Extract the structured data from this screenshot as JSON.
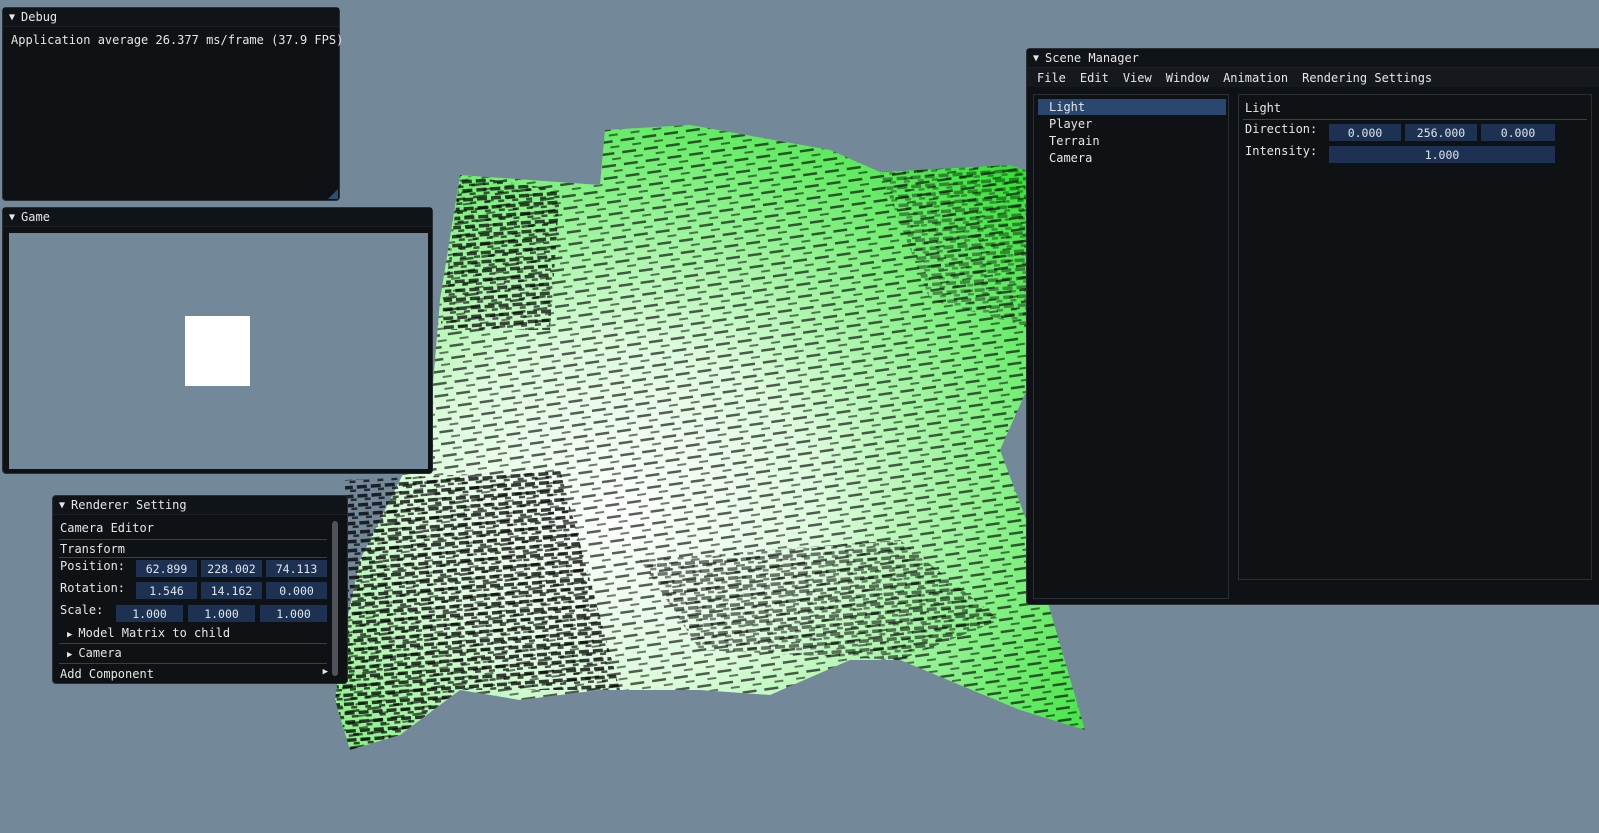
{
  "colors": {
    "background": "#73899a",
    "window_bg": "#0f1215",
    "field_bg": "#1d3253",
    "selection_bg": "#2a4770",
    "terrain_green": "#2ee02e",
    "terrain_white": "#ffffff"
  },
  "debug": {
    "title": "Debug",
    "fps_text": "Application average 26.377 ms/frame (37.9 FPS)"
  },
  "game": {
    "title": "Game"
  },
  "renderer": {
    "title": "Renderer Setting",
    "camera_editor": "Camera Editor",
    "transform": "Transform",
    "position_label": "Position:",
    "position": [
      "62.899",
      "228.002",
      "74.113"
    ],
    "rotation_label": "Rotation:",
    "rotation": [
      "1.546",
      "14.162",
      "0.000"
    ],
    "scale_label": "Scale:",
    "scale": [
      "1.000",
      "1.000",
      "1.000"
    ],
    "model_matrix": "Model Matrix to child",
    "camera_node": "Camera",
    "add_component": "Add Component"
  },
  "scene": {
    "title": "Scene Manager",
    "menu": [
      "File",
      "Edit",
      "View",
      "Window",
      "Animation",
      "Rendering Settings"
    ],
    "objects": [
      "Light",
      "Player",
      "Terrain",
      "Camera"
    ],
    "selected": "Light",
    "inspector": {
      "title": "Light",
      "direction_label": "Direction:",
      "direction": [
        "0.000",
        "256.000",
        "0.000"
      ],
      "intensity_label": "Intensity:",
      "intensity": "1.000"
    }
  }
}
